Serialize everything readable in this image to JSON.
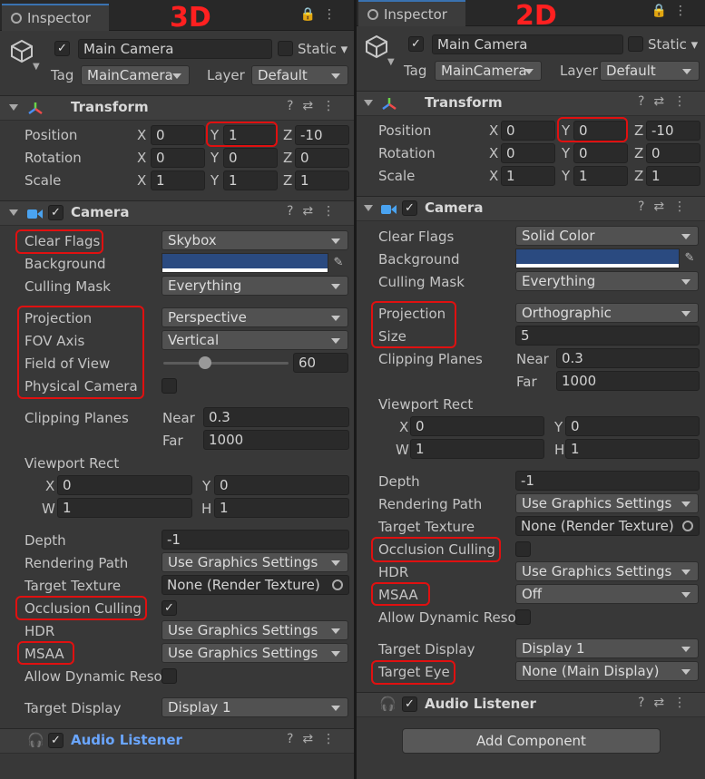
{
  "left": {
    "tab_title": "Inspector",
    "big_label": "3D",
    "header": {
      "object_name": "Main Camera",
      "static_label": "Static",
      "tag_label": "Tag",
      "tag_value": "MainCamera",
      "layer_label": "Layer",
      "layer_value": "Default"
    },
    "transform": {
      "title": "Transform",
      "position_label": "Position",
      "rotation_label": "Rotation",
      "scale_label": "Scale",
      "position": {
        "x": "0",
        "y": "1",
        "z": "-10"
      },
      "rotation": {
        "x": "0",
        "y": "0",
        "z": "0"
      },
      "scale": {
        "x": "1",
        "y": "1",
        "z": "1"
      }
    },
    "camera": {
      "title": "Camera",
      "clear_flags_label": "Clear Flags",
      "clear_flags_value": "Skybox",
      "background_label": "Background",
      "culling_mask_label": "Culling Mask",
      "culling_mask_value": "Everything",
      "projection_label": "Projection",
      "projection_value": "Perspective",
      "fov_axis_label": "FOV Axis",
      "fov_axis_value": "Vertical",
      "fov_label": "Field of View",
      "fov_value": "60",
      "physical_camera_label": "Physical Camera",
      "clipping_label": "Clipping Planes",
      "near_label": "Near",
      "near_value": "0.3",
      "far_label": "Far",
      "far_value": "1000",
      "viewport_label": "Viewport Rect",
      "vx": "0",
      "vy": "0",
      "vw": "1",
      "vh": "1",
      "depth_label": "Depth",
      "depth_value": "-1",
      "rendering_path_label": "Rendering Path",
      "rendering_path_value": "Use Graphics Settings",
      "target_texture_label": "Target Texture",
      "target_texture_value": "None (Render Texture)",
      "occlusion_label": "Occlusion Culling",
      "hdr_label": "HDR",
      "hdr_value": "Use Graphics Settings",
      "msaa_label": "MSAA",
      "msaa_value": "Use Graphics Settings",
      "dynamic_label": "Allow Dynamic Reso",
      "target_display_label": "Target Display",
      "target_display_value": "Display 1"
    },
    "audio_listener": "Audio Listener"
  },
  "right": {
    "tab_title": "Inspector",
    "big_label": "2D",
    "header": {
      "object_name": "Main Camera",
      "static_label": "Static",
      "tag_label": "Tag",
      "tag_value": "MainCamera",
      "layer_label": "Layer",
      "layer_value": "Default"
    },
    "transform": {
      "title": "Transform",
      "position_label": "Position",
      "rotation_label": "Rotation",
      "scale_label": "Scale",
      "position": {
        "x": "0",
        "y": "0",
        "z": "-10"
      },
      "rotation": {
        "x": "0",
        "y": "0",
        "z": "0"
      },
      "scale": {
        "x": "1",
        "y": "1",
        "z": "1"
      }
    },
    "camera": {
      "title": "Camera",
      "clear_flags_label": "Clear Flags",
      "clear_flags_value": "Solid Color",
      "background_label": "Background",
      "culling_mask_label": "Culling Mask",
      "culling_mask_value": "Everything",
      "projection_label": "Projection",
      "projection_value": "Orthographic",
      "size_label": "Size",
      "size_value": "5",
      "clipping_label": "Clipping Planes",
      "near_label": "Near",
      "near_value": "0.3",
      "far_label": "Far",
      "far_value": "1000",
      "viewport_label": "Viewport Rect",
      "vx": "0",
      "vy": "0",
      "vw": "1",
      "vh": "1",
      "depth_label": "Depth",
      "depth_value": "-1",
      "rendering_path_label": "Rendering Path",
      "rendering_path_value": "Use Graphics Settings",
      "target_texture_label": "Target Texture",
      "target_texture_value": "None (Render Texture)",
      "occlusion_label": "Occlusion Culling",
      "hdr_label": "HDR",
      "hdr_value": "Use Graphics Settings",
      "msaa_label": "MSAA",
      "msaa_value": "Off",
      "dynamic_label": "Allow Dynamic Reso",
      "target_display_label": "Target Display",
      "target_display_value": "Display 1",
      "target_eye_label": "Target Eye",
      "target_eye_value": "None (Main Display)"
    },
    "audio_listener": "Audio Listener",
    "add_component": "Add Component"
  },
  "colors": {
    "highlight": "#e01010",
    "background_swatch": "#2a4a80",
    "label_red": "#ff2020"
  }
}
